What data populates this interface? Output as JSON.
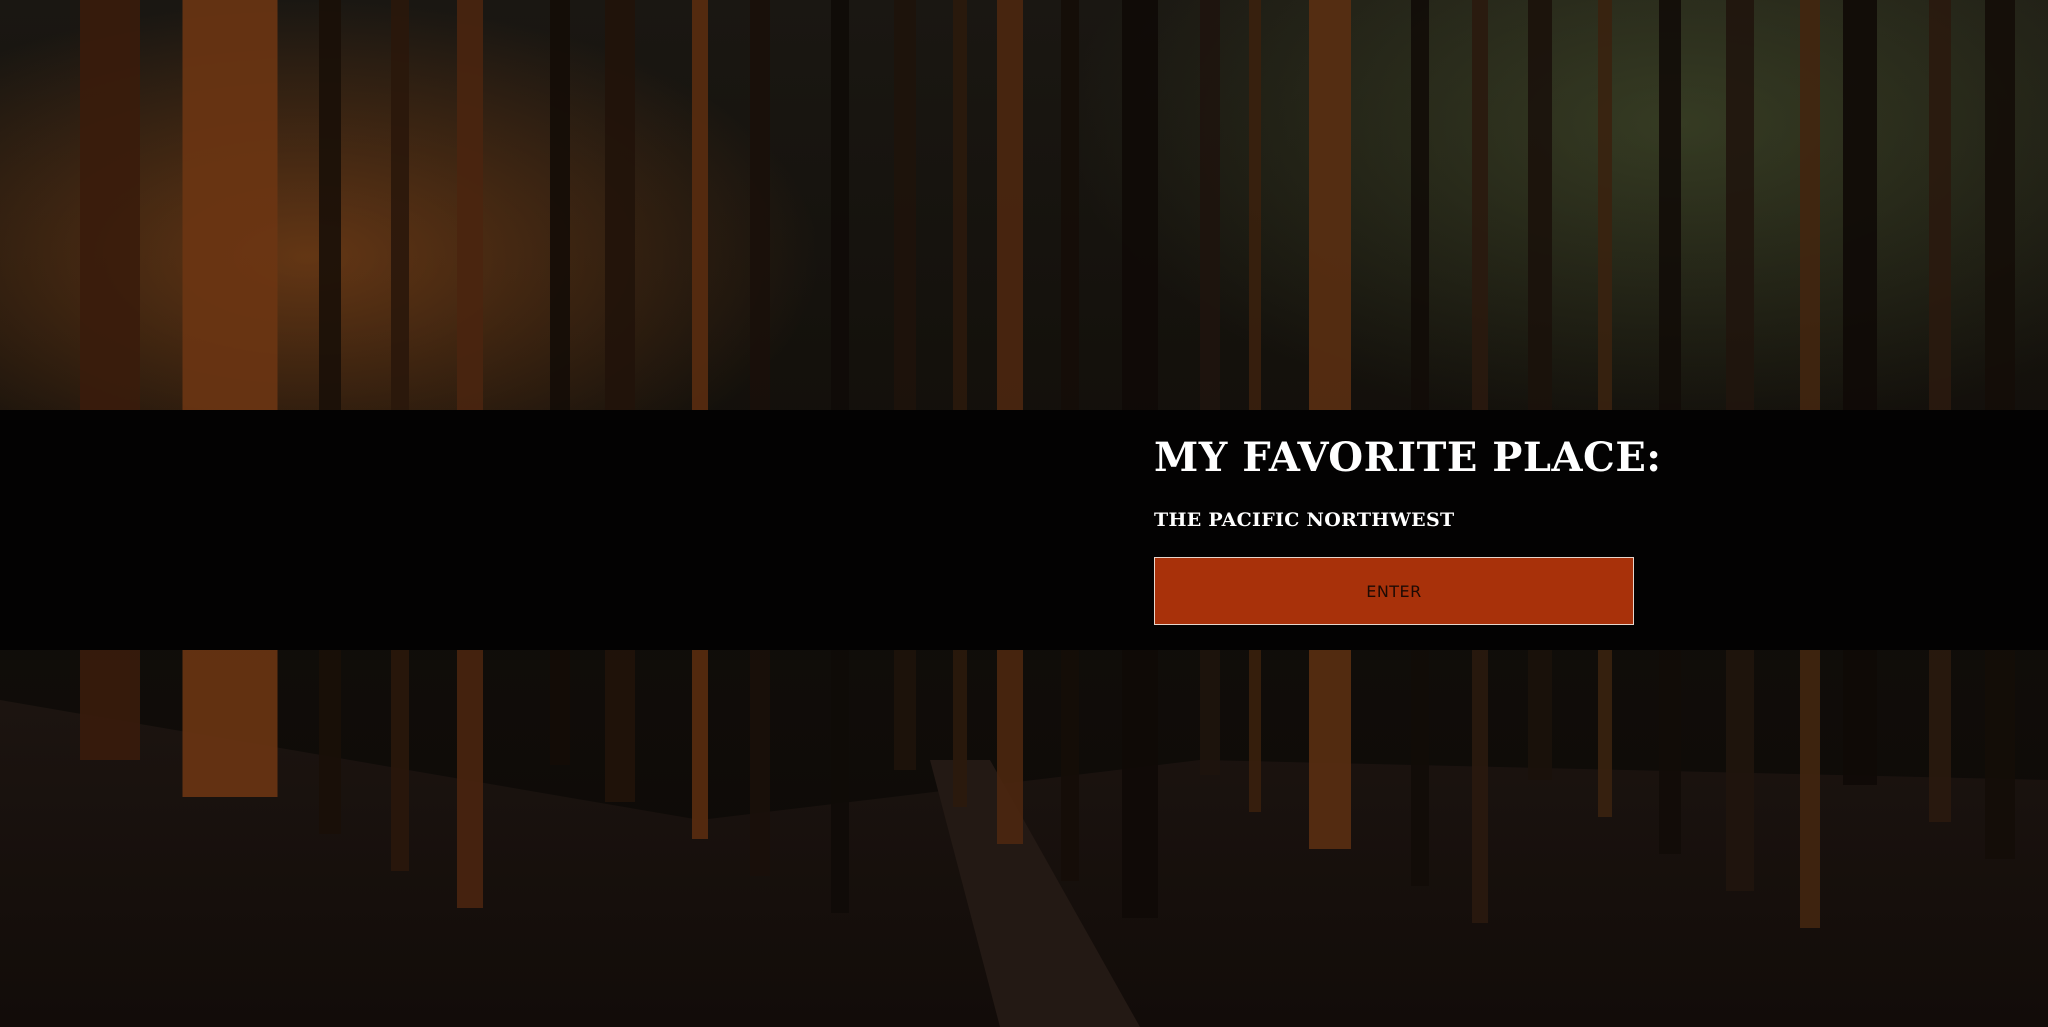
{
  "hero": {
    "title": "MY FAVORITE PLACE:",
    "subtitle": "THE PACIFIC NORTHWEST",
    "enter_label": "ENTER"
  },
  "background": {
    "subject": "dark forest with sunlit tree trunks and a trail"
  },
  "colors": {
    "band": "#030202",
    "button": "#a8310a",
    "button_text": "#1d0a04",
    "text": "#ffffff"
  }
}
